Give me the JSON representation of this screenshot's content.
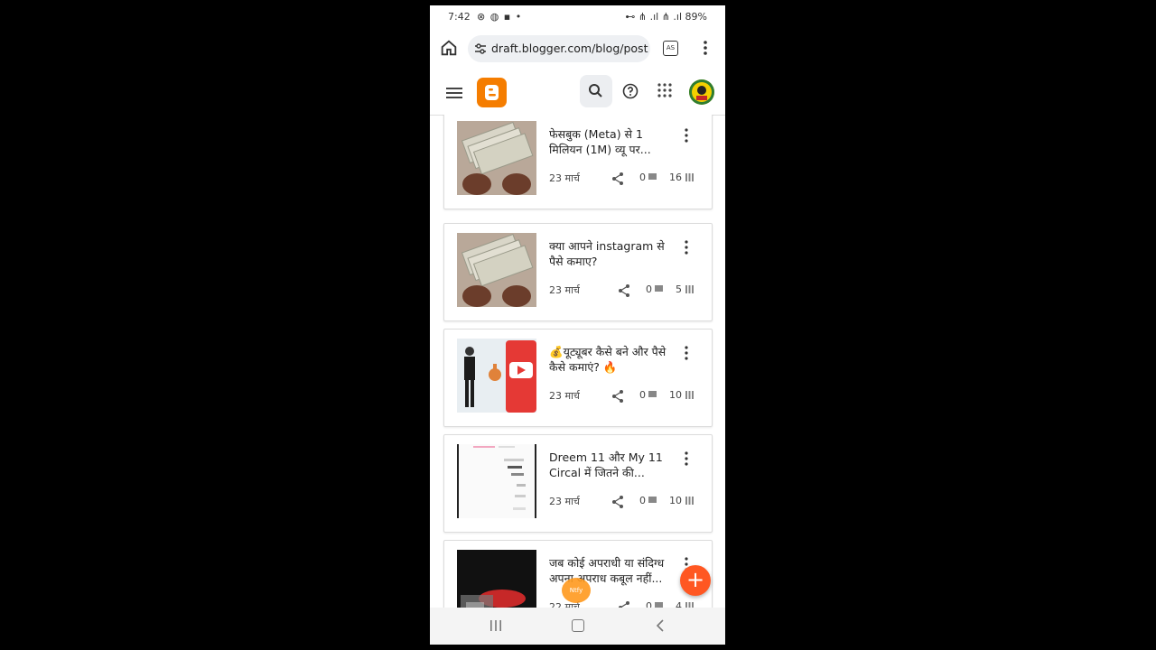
{
  "status_bar": {
    "time": "7:42",
    "left_icons": "⊗ ◍ ▪ •",
    "right_text": "⊷ ⋔ .ıl ⋔ .ıl 89%"
  },
  "browser": {
    "url": "draft.blogger.com/blog/post",
    "tab_count": "AS"
  },
  "posts": [
    {
      "title": "फेसबुक (Meta) से 1 मिलियन (1M) व्यू पर...",
      "date": "23 मार्च",
      "comments": "0",
      "views": "16",
      "thumb": "cash"
    },
    {
      "title": "क्या आपने instagram से पैसे कमाए?",
      "date": "23 मार्च",
      "comments": "0",
      "views": "5",
      "thumb": "cash"
    },
    {
      "title": "💰यूट्यूबर कैसे बने और पैसे कैसे कमाएं? 🔥",
      "date": "23 मार्च",
      "comments": "0",
      "views": "10",
      "thumb": "youtuber"
    },
    {
      "title": "Dreem 11 और My 11 Circal में जितने की...",
      "date": "23 मार्च",
      "comments": "0",
      "views": "10",
      "thumb": "screenshot"
    },
    {
      "title": "जब कोई अपराधी या संदिग्ध अपना अपराध कबूल नहीं...",
      "date": "22 मार्च",
      "comments": "0",
      "views": "4",
      "thumb": "dark"
    }
  ],
  "fab_label": "+",
  "badge_label": "Ntfy",
  "icons": [
    "home-icon",
    "tune-icon",
    "tab-switcher-icon",
    "more-vert-icon",
    "menu-icon",
    "blogger-logo",
    "search-icon",
    "help-icon",
    "apps-icon",
    "avatar",
    "share-icon",
    "comment-icon",
    "views-icon",
    "add-icon",
    "recent-apps-icon",
    "home-nav-icon",
    "back-icon"
  ],
  "colors": {
    "blogger_orange": "#f57d00",
    "fab": "#ff5722"
  }
}
